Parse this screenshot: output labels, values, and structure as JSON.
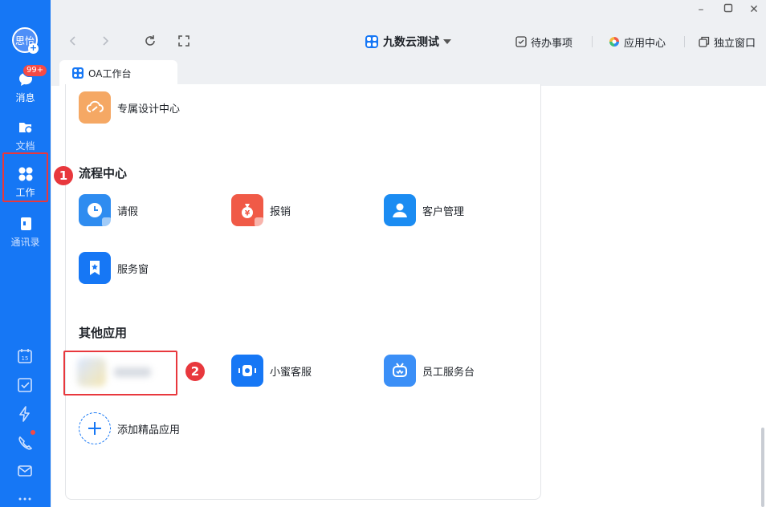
{
  "sidebar": {
    "avatar_text": "思怡",
    "badge": "99+",
    "items": [
      {
        "label": "消息"
      },
      {
        "label": "文档"
      },
      {
        "label": "工作"
      },
      {
        "label": "通讯录"
      }
    ]
  },
  "window": {
    "title": "九数云测试",
    "actions": [
      {
        "label": "待办事项",
        "icon": "checkbox-icon"
      },
      {
        "label": "应用中心",
        "icon": "app-center-icon"
      },
      {
        "label": "独立窗口",
        "icon": "window-icon"
      }
    ]
  },
  "tab": {
    "label": "OA工作台"
  },
  "content": {
    "top_app": {
      "label": "专属设计中心",
      "color": "#f5a864"
    },
    "sections": [
      {
        "title": "流程中心",
        "apps": [
          {
            "label": "请假",
            "color": "#2e8cf0",
            "icon": "clock-icon"
          },
          {
            "label": "报销",
            "color": "#f05a47",
            "icon": "money-bag-icon"
          },
          {
            "label": "客户管理",
            "color": "#1b8cf2",
            "icon": "person-icon"
          },
          {
            "label": "服务窗",
            "color": "#1677f5",
            "icon": "bookmark-star-icon"
          }
        ]
      },
      {
        "title": "其他应用",
        "apps": [
          {
            "label": "小蜜客服",
            "color": "#1677f5",
            "icon": "service-robot-icon"
          },
          {
            "label": "员工服务台",
            "color": "#3b8ff7",
            "icon": "helpdesk-icon"
          }
        ],
        "add_label": "添加精品应用"
      }
    ]
  },
  "annotations": {
    "callout_1": "1",
    "callout_2": "2",
    "color": "#e8383d"
  }
}
